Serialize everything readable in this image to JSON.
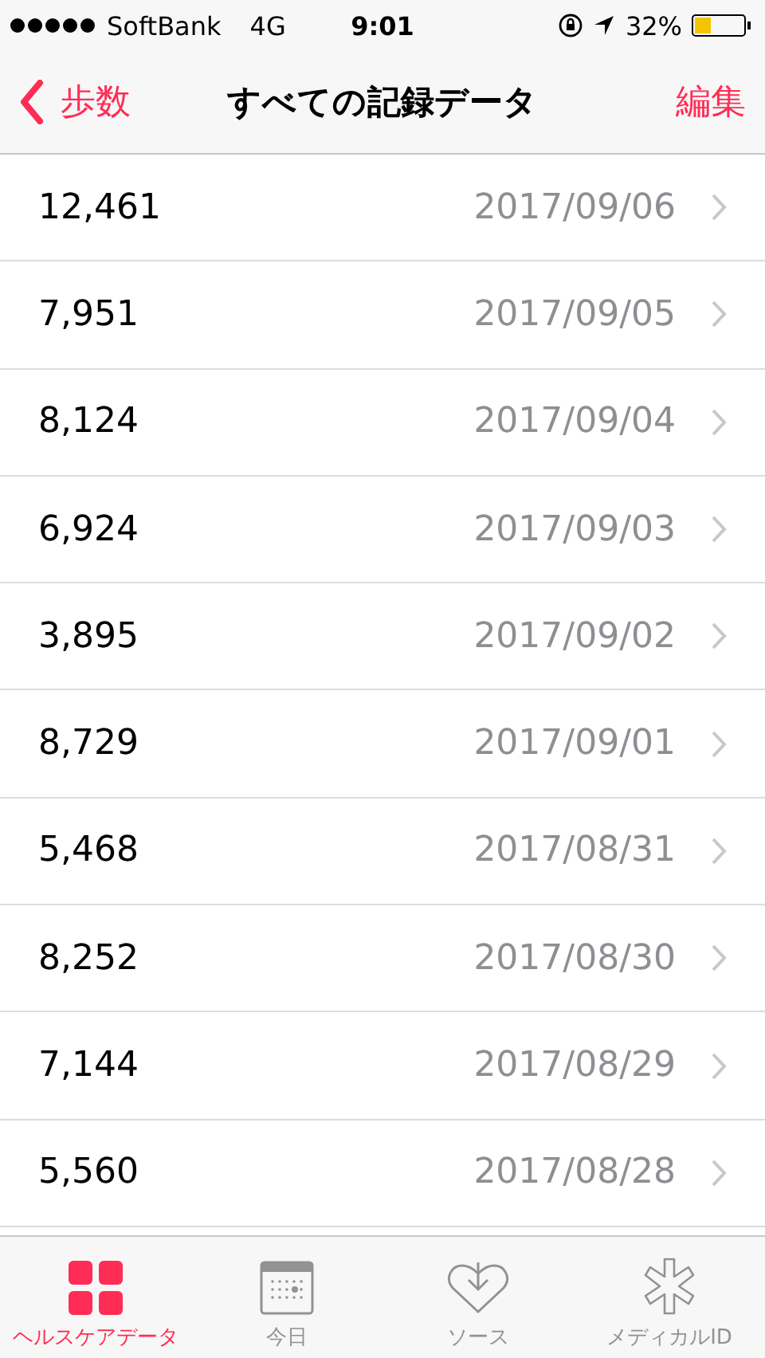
{
  "status_bar": {
    "carrier": "SoftBank",
    "network": "4G",
    "time": "9:01",
    "battery": "32%"
  },
  "nav": {
    "back": "歩数",
    "title": "すべての記録データ",
    "action": "編集"
  },
  "rows": [
    {
      "value": "12,461",
      "date": "2017/09/06"
    },
    {
      "value": "7,951",
      "date": "2017/09/05"
    },
    {
      "value": "8,124",
      "date": "2017/09/04"
    },
    {
      "value": "6,924",
      "date": "2017/09/03"
    },
    {
      "value": "3,895",
      "date": "2017/09/02"
    },
    {
      "value": "8,729",
      "date": "2017/09/01"
    },
    {
      "value": "5,468",
      "date": "2017/08/31"
    },
    {
      "value": "8,252",
      "date": "2017/08/30"
    },
    {
      "value": "7,144",
      "date": "2017/08/29"
    },
    {
      "value": "5,560",
      "date": "2017/08/28"
    }
  ],
  "tabs": [
    {
      "kind": "grid",
      "label": "ヘルスケアデータ",
      "selected": true
    },
    {
      "kind": "calendar",
      "label": "今日",
      "selected": false
    },
    {
      "kind": "heart",
      "label": "ソース",
      "selected": false
    },
    {
      "kind": "star",
      "label": "メディカルID",
      "selected": false
    }
  ]
}
